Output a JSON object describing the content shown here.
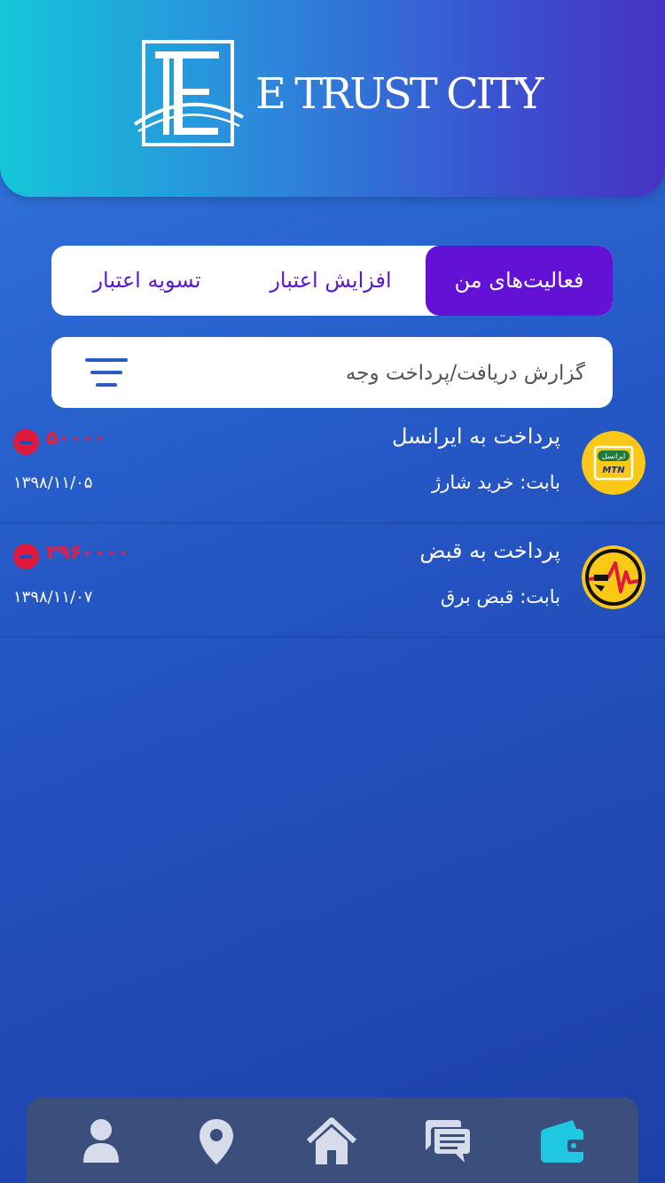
{
  "header": {
    "brand_name": "E TRUST CITY"
  },
  "tabs": [
    {
      "label": "فعالیت‌های من",
      "active": true
    },
    {
      "label": "افزایش اعتبار",
      "active": false
    },
    {
      "label": "تسویه اعتبار",
      "active": false
    }
  ],
  "search": {
    "placeholder": "گزارش دریافت/پرداخت وجه",
    "value": ""
  },
  "transactions": [
    {
      "title": "پرداخت به ایرانسل",
      "subtitle": "بابت: خرید شارژ",
      "amount": "۵۰۰۰۰",
      "date": "۱۳۹۸/۱۱/۰۵",
      "icon": "irancell-mtn-logo",
      "logo_text_fa": "ایرانسل",
      "logo_text_en": "MTN"
    },
    {
      "title": "پرداخت به قبض",
      "subtitle": "بابت: قبض برق",
      "amount": "۲۹۶۰۰۰۰",
      "date": "۱۳۹۸/۱۱/۰۷",
      "icon": "electricity-bill-logo"
    }
  ],
  "bottom_nav": [
    {
      "icon": "user-icon"
    },
    {
      "icon": "location-pin-icon"
    },
    {
      "icon": "home-icon"
    },
    {
      "icon": "chat-icon"
    },
    {
      "icon": "wallet-icon",
      "active": true
    }
  ],
  "colors": {
    "header_start": "#14c6d8",
    "header_end": "#4632c4",
    "tab_active": "#6411d6",
    "amount_negative": "#ee1c3a",
    "nav_bg": "#3a4f7c",
    "nav_icon": "#d7dcea",
    "nav_active": "#1fc8e0"
  }
}
